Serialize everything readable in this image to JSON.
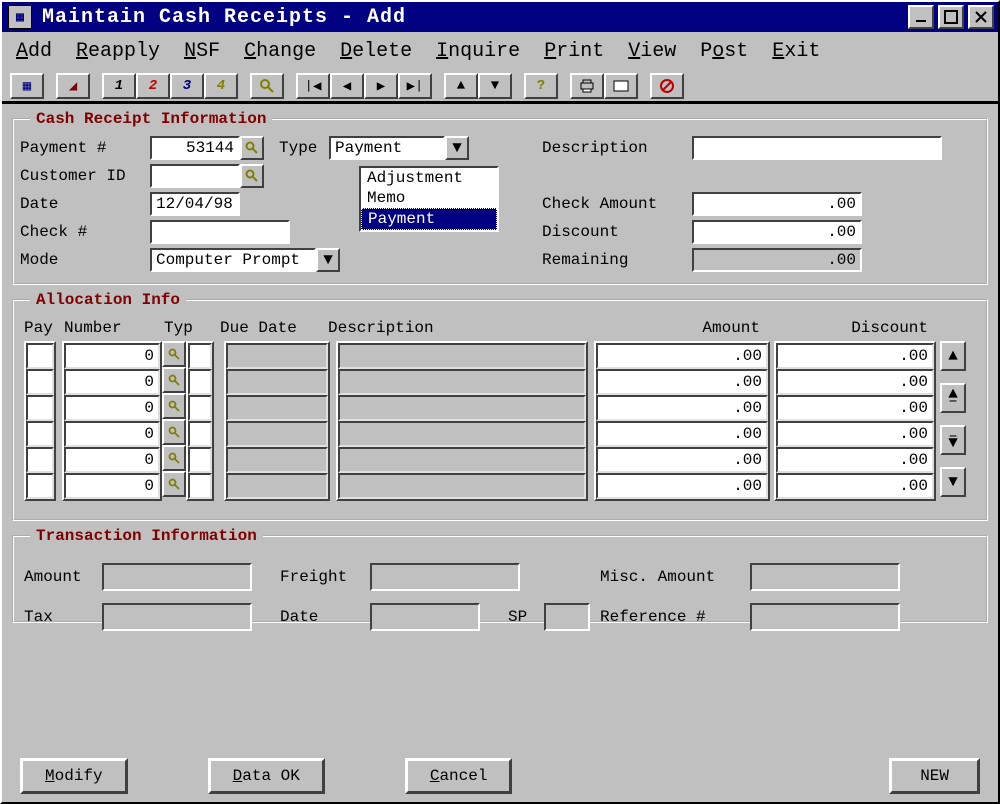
{
  "window": {
    "title": "Maintain Cash Receipts - Add"
  },
  "menu": {
    "add": "Add",
    "reapply": "Reapply",
    "nsf": "NSF",
    "change": "Change",
    "delete": "Delete",
    "inquire": "Inquire",
    "print": "Print",
    "view": "View",
    "post": "Post",
    "exit": "Exit"
  },
  "toolbar": {
    "n1": "1",
    "n2": "2",
    "n3": "3",
    "n4": "4"
  },
  "cri_legend": "Cash Receipt Information",
  "cri": {
    "payment_label": "Payment #",
    "payment_value": "53144",
    "type_label": "Type",
    "type_value": "Payment",
    "customer_label": "Customer ID",
    "customer_value": "",
    "date_label": "Date",
    "date_value": "12/04/98",
    "check_label": "Check #",
    "check_value": "",
    "mode_label": "Mode",
    "mode_value": "Computer Prompt",
    "desc_label": "Description",
    "desc_value": "",
    "chkamt_label": "Check Amount",
    "chkamt_value": ".00",
    "discount_label": "Discount",
    "discount_value": ".00",
    "remaining_label": "Remaining",
    "remaining_value": ".00",
    "type_options": [
      "Adjustment",
      "Memo",
      "Payment"
    ],
    "type_selected_index": 2
  },
  "alloc_legend": "Allocation Info",
  "alloc": {
    "head_pay": "Pay",
    "head_number": "Number",
    "head_typ": "Typ",
    "head_due": "Due Date",
    "head_desc": "Description",
    "head_amount": "Amount",
    "head_discount": "Discount",
    "rows": [
      {
        "pay": "",
        "number": "0",
        "typ": "",
        "due": "",
        "desc": "",
        "amount": ".00",
        "discount": ".00"
      },
      {
        "pay": "",
        "number": "0",
        "typ": "",
        "due": "",
        "desc": "",
        "amount": ".00",
        "discount": ".00"
      },
      {
        "pay": "",
        "number": "0",
        "typ": "",
        "due": "",
        "desc": "",
        "amount": ".00",
        "discount": ".00"
      },
      {
        "pay": "",
        "number": "0",
        "typ": "",
        "due": "",
        "desc": "",
        "amount": ".00",
        "discount": ".00"
      },
      {
        "pay": "",
        "number": "0",
        "typ": "",
        "due": "",
        "desc": "",
        "amount": ".00",
        "discount": ".00"
      },
      {
        "pay": "",
        "number": "0",
        "typ": "",
        "due": "",
        "desc": "",
        "amount": ".00",
        "discount": ".00"
      }
    ]
  },
  "txn_legend": "Transaction Information",
  "txn": {
    "amount_label": "Amount",
    "freight_label": "Freight",
    "misc_label": "Misc. Amount",
    "tax_label": "Tax",
    "date_label": "Date",
    "sp_label": "SP",
    "ref_label": "Reference #"
  },
  "buttons": {
    "modify": "Modify",
    "dataok": "Data OK",
    "cancel": "Cancel",
    "new": "NEW"
  }
}
